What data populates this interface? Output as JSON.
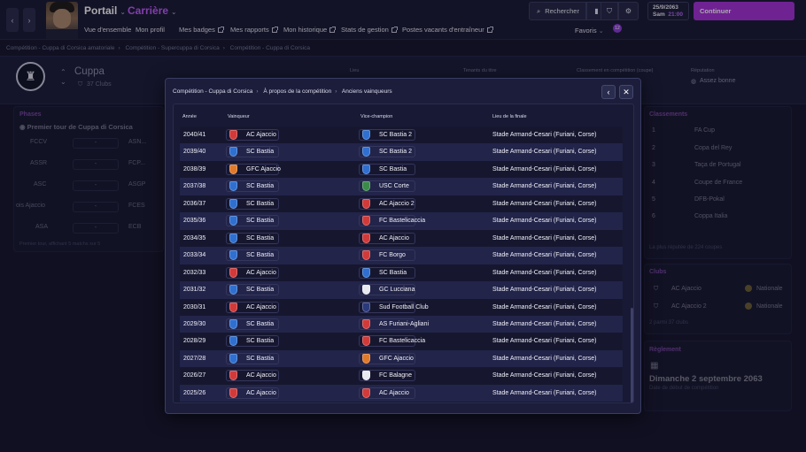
{
  "topbar": {
    "back_icon": "chevron-left-icon",
    "forward_icon": "chevron-right-icon",
    "portail": "Portail",
    "carriere": "Carrière",
    "menu": [
      "Vue d'ensemble",
      "Mon profil",
      "Mes badges",
      "Mes rapports",
      "Mon historique",
      "Stats de gestion",
      "Postes vacants d'entraîneur"
    ],
    "search_label": "Rechercher",
    "date": "25/9/2063",
    "day": "Sam",
    "time": "21:00",
    "continue_label": "Continuer",
    "favoris": "Favoris",
    "favoris_badge": "12",
    "accent": "#a630d8"
  },
  "breadcrumb": [
    "Compétition - Cuppa di Corsica amatoriale",
    "Compétition - Supercuppa di Corsica",
    "Compétition - Cuppa di Corsica"
  ],
  "competition": {
    "name": "Cuppa",
    "clubs": "37 Clubs",
    "header_labels": [
      "Lieu",
      "Tenants du titre",
      "Classement en compétition (coupe)",
      "Réputation"
    ],
    "reputation": "Assez bonne"
  },
  "phases": {
    "title": "Phases",
    "round": "Premier tour de Cuppa di Corsica",
    "matches": [
      {
        "home": "FCCV",
        "score": "-",
        "away": "ASN..."
      },
      {
        "home": "ASSR",
        "score": "-",
        "away": "FCP..."
      },
      {
        "home": "ASC",
        "score": "-",
        "away": "ASGP"
      },
      {
        "home": "ois Ajaccio",
        "score": "-",
        "away": "FCES"
      },
      {
        "home": "ASA",
        "score": "-",
        "away": "ECB"
      }
    ],
    "footer": "Premier tour, affichant 5 matchs sur 5"
  },
  "classements": {
    "title": "Classements",
    "items": [
      {
        "rank": "1",
        "name": "FA Cup"
      },
      {
        "rank": "2",
        "name": "Copa del Rey"
      },
      {
        "rank": "3",
        "name": "Taça de Portugal"
      },
      {
        "rank": "4",
        "name": "Coupe de France"
      },
      {
        "rank": "5",
        "name": "DFB-Pokal"
      },
      {
        "rank": "6",
        "name": "Coppa Italia"
      }
    ],
    "footer": "La plus réputée de 224 coupes"
  },
  "clubs": {
    "title": "Clubs",
    "items": [
      {
        "name": "AC Ajaccio",
        "scope": "Nationale"
      },
      {
        "name": "AC Ajaccio 2",
        "scope": "Nationale"
      }
    ],
    "footer": "2 parmi 37 clubs"
  },
  "reglement": {
    "title": "Règlement",
    "date": "Dimanche 2 septembre 2063",
    "label": "Date de début de compétition"
  },
  "modal": {
    "breadcrumb": [
      "Compétition - Cuppa di Corsica",
      "À propos de la compétition",
      "Anciens vainqueurs"
    ],
    "back_icon": "chevron-left-icon",
    "close_icon": "close-icon",
    "columns": [
      "Année",
      "Vainqueur",
      "Vice-champion",
      "Lieu de la finale"
    ],
    "rows": [
      {
        "year": "2040/41",
        "winner": "AC Ajaccio",
        "wc": "red",
        "runner": "SC Bastia 2",
        "rc": "blue",
        "venue": "Stade Armand-Cesari (Furiani, Corse)"
      },
      {
        "year": "2039/40",
        "winner": "SC Bastia",
        "wc": "blue",
        "runner": "SC Bastia 2",
        "rc": "blue",
        "venue": "Stade Armand-Cesari (Furiani, Corse)"
      },
      {
        "year": "2038/39",
        "winner": "GFC Ajaccio",
        "wc": "orange",
        "runner": "SC Bastia",
        "rc": "blue",
        "venue": "Stade Armand-Cesari (Furiani, Corse)"
      },
      {
        "year": "2037/38",
        "winner": "SC Bastia",
        "wc": "blue",
        "runner": "USC Corte",
        "rc": "green",
        "venue": "Stade Armand-Cesari (Furiani, Corse)"
      },
      {
        "year": "2036/37",
        "winner": "SC Bastia",
        "wc": "blue",
        "runner": "AC Ajaccio 2",
        "rc": "red",
        "venue": "Stade Armand-Cesari (Furiani, Corse)"
      },
      {
        "year": "2035/36",
        "winner": "SC Bastia",
        "wc": "blue",
        "runner": "FC Bastelicaccia",
        "rc": "red",
        "venue": "Stade Armand-Cesari (Furiani, Corse)"
      },
      {
        "year": "2034/35",
        "winner": "SC Bastia",
        "wc": "blue",
        "runner": "AC Ajaccio",
        "rc": "red",
        "venue": "Stade Armand-Cesari (Furiani, Corse)"
      },
      {
        "year": "2033/34",
        "winner": "SC Bastia",
        "wc": "blue",
        "runner": "FC Borgo",
        "rc": "red",
        "venue": "Stade Armand-Cesari (Furiani, Corse)"
      },
      {
        "year": "2032/33",
        "winner": "AC Ajaccio",
        "wc": "red",
        "runner": "SC Bastia",
        "rc": "blue",
        "venue": "Stade Armand-Cesari (Furiani, Corse)"
      },
      {
        "year": "2031/32",
        "winner": "SC Bastia",
        "wc": "blue",
        "runner": "GC Lucciana",
        "rc": "white",
        "venue": "Stade Armand-Cesari (Furiani, Corse)"
      },
      {
        "year": "2030/31",
        "winner": "AC Ajaccio",
        "wc": "red",
        "runner": "Sud Football Club",
        "rc": "navy",
        "venue": "Stade Armand-Cesari (Furiani, Corse)"
      },
      {
        "year": "2029/30",
        "winner": "SC Bastia",
        "wc": "blue",
        "runner": "AS Furiani-Agliani",
        "rc": "red",
        "venue": "Stade Armand-Cesari (Furiani, Corse)"
      },
      {
        "year": "2028/29",
        "winner": "SC Bastia",
        "wc": "blue",
        "runner": "FC Bastelicaccia",
        "rc": "red",
        "venue": "Stade Armand-Cesari (Furiani, Corse)"
      },
      {
        "year": "2027/28",
        "winner": "SC Bastia",
        "wc": "blue",
        "runner": "GFC Ajaccio",
        "rc": "orange",
        "venue": "Stade Armand-Cesari (Furiani, Corse)"
      },
      {
        "year": "2026/27",
        "winner": "AC Ajaccio",
        "wc": "red",
        "runner": "FC Balagne",
        "rc": "white",
        "venue": "Stade Armand-Cesari (Furiani, Corse)"
      },
      {
        "year": "2025/26",
        "winner": "AC Ajaccio",
        "wc": "red",
        "runner": "AC Ajaccio",
        "rc": "red",
        "venue": "Stade Armand-Cesari (Furiani, Corse)"
      }
    ]
  }
}
